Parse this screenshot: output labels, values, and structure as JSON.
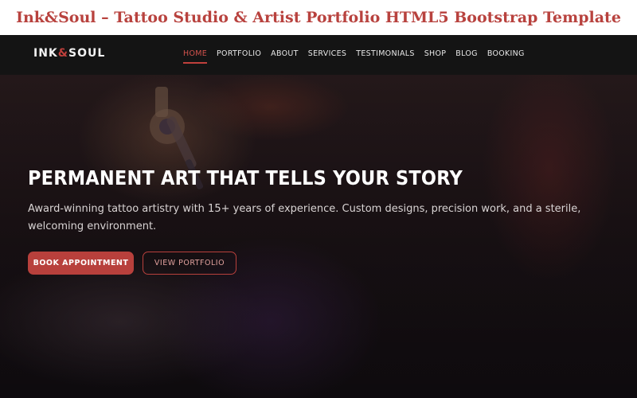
{
  "page_title": "Ink&Soul – Tattoo Studio & Artist Portfolio HTML5 Bootstrap Template",
  "brand": {
    "logo_part1": "INK",
    "logo_amp": "&",
    "logo_part2": "SOUL"
  },
  "nav": {
    "items": [
      {
        "label": "HOME",
        "active": true
      },
      {
        "label": "PORTFOLIO",
        "active": false
      },
      {
        "label": "ABOUT",
        "active": false
      },
      {
        "label": "SERVICES",
        "active": false
      },
      {
        "label": "TESTIMONIALS",
        "active": false
      },
      {
        "label": "SHOP",
        "active": false
      },
      {
        "label": "BLOG",
        "active": false
      },
      {
        "label": "BOOKING",
        "active": false
      }
    ]
  },
  "hero": {
    "headline": "PERMANENT ART THAT TELLS YOUR STORY",
    "description": "Award-winning tattoo artistry with 15+ years of experience. Custom designs, precision work, and a sterile, welcoming environment.",
    "primary_button": "BOOK APPOINTMENT",
    "secondary_button": "VIEW PORTFOLIO"
  },
  "colors": {
    "accent": "#b8403c",
    "navbar_bg": "#141414",
    "title_color": "#b8423e"
  }
}
